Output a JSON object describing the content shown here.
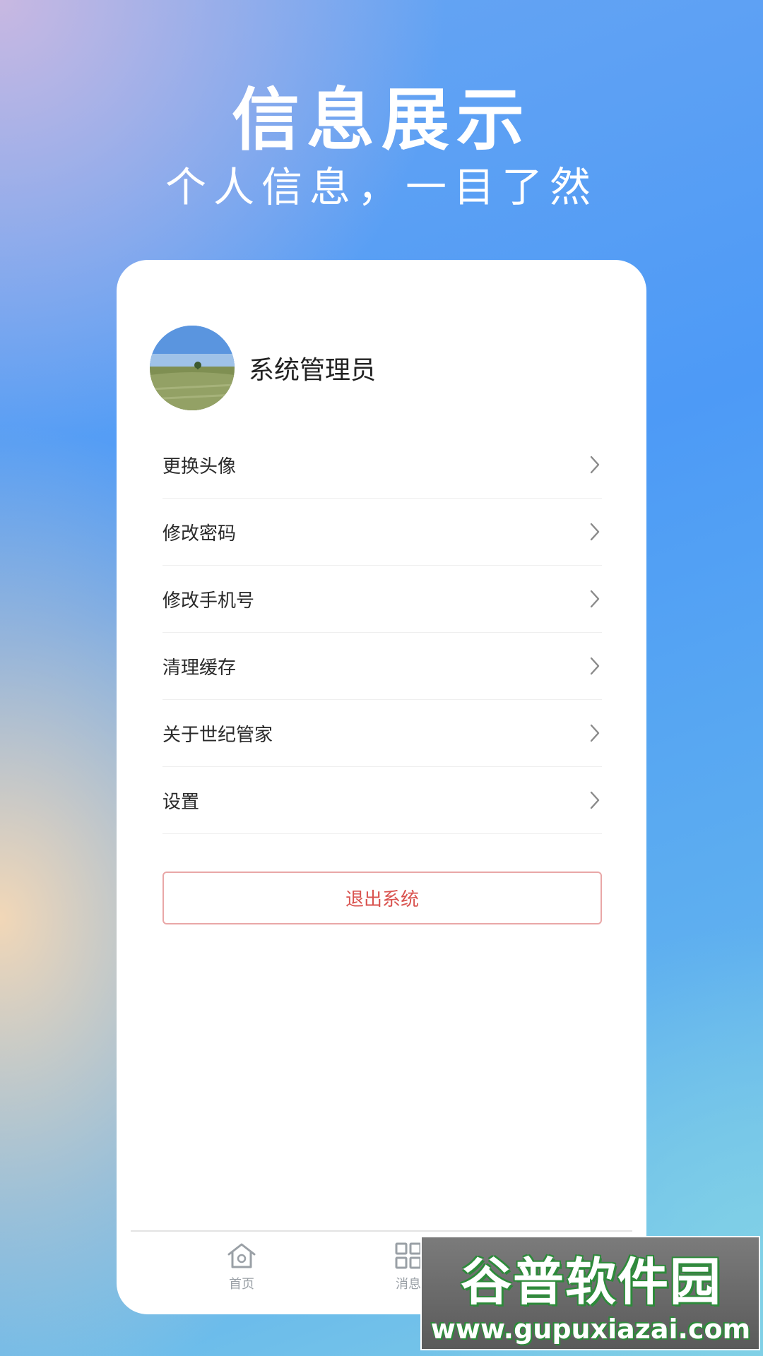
{
  "hero": {
    "title": "信息展示",
    "subtitle": "个人信息，一目了然"
  },
  "profile": {
    "username": "系统管理员",
    "avatar_icon": "field-photo-avatar"
  },
  "menu": {
    "items": [
      {
        "label": "更换头像",
        "icon": "chevron-right-icon"
      },
      {
        "label": "修改密码",
        "icon": "chevron-right-icon"
      },
      {
        "label": "修改手机号",
        "icon": "chevron-right-icon"
      },
      {
        "label": "清理缓存",
        "icon": "chevron-right-icon"
      },
      {
        "label": "关于世纪管家",
        "icon": "chevron-right-icon"
      },
      {
        "label": "设置",
        "icon": "chevron-right-icon"
      }
    ]
  },
  "logout": {
    "label": "退出系统",
    "color": "#d9534f"
  },
  "tabbar": {
    "tabs": [
      {
        "label": "首页",
        "icon": "home-icon"
      },
      {
        "label": "消息",
        "icon": "grid-icon"
      }
    ]
  },
  "watermark": {
    "brand": "谷普软件园",
    "url": "www.gupuxiazai.com"
  },
  "colors": {
    "accent": "#4d9af6",
    "danger": "#d9534f",
    "brand_green": "#2d8a3a"
  }
}
